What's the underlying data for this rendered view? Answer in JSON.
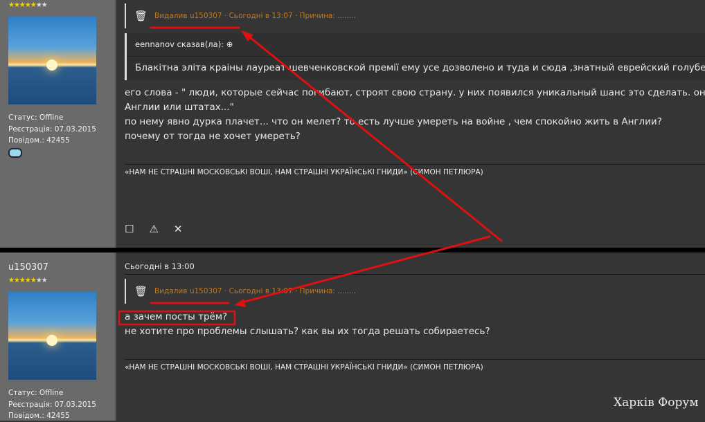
{
  "posts": [
    {
      "stars": 5,
      "stars_total": 7,
      "deleted_notice": "Видалив u150307 · Сьогодні в 13:07 · Причина: ........",
      "quote": {
        "author": "eennanov сказав(ла):",
        "text": "Блакітна эліта краіны лауреат шевченковской премії ему усе дозволено и туда и сюда ,знатный еврейский голубец ещё"
      },
      "lines": [
        "его слова - \" люди, которые сейчас погибают, строят свою страну. у них появился уникальный шанс это сделать. они не м",
        "Англии или штатах...\"",
        "по нему явно дурка плачет... что он мелет? то есть лучше умереть на войне , чем спокойно жить в Англии?",
        "почему от тогда не хочет умереть?"
      ],
      "status": "Статус: Offline",
      "registration": "Реєстрація: 07.03.2015",
      "messages": "Повідом.: 42455",
      "signature": "«НАМ НЕ СТРАШНІ МОСКОВСЬКІ ВОШІ, НАМ СТРАШНІ УКРАЇНСЬКІ ГНИДИ» (СИМОН ПЕТЛЮРА)"
    },
    {
      "username": "u150307",
      "stars": 5,
      "stars_total": 7,
      "date": "Сьогодні в 13:00",
      "deleted_notice": "Видалив u150307 · Сьогодні в 13:07 · Причина: ........",
      "lines": [
        "а зачем посты трём?",
        "не хотите про проблемы слышать? как вы их тогда решать собираетесь?"
      ],
      "status": "Статус: Offline",
      "registration": "Реєстрація: 07.03.2015",
      "messages": "Повідом.: 42455",
      "signature": "«НАМ НЕ СТРАШНІ МОСКОВСЬКІ ВОШІ, НАМ СТРАШНІ УКРАЇНСЬКІ ГНИДИ» (СИМОН ПЕТЛЮРА)"
    }
  ],
  "icons": {
    "trash": "trash-icon",
    "quote_up": "arrow-up-circle-icon",
    "select": "checkbox-icon",
    "report": "warning-icon",
    "delete": "close-icon"
  },
  "watermark": "Харків Форум",
  "colors": {
    "annotation": "#e01010",
    "deleted_text": "#c07a24"
  }
}
